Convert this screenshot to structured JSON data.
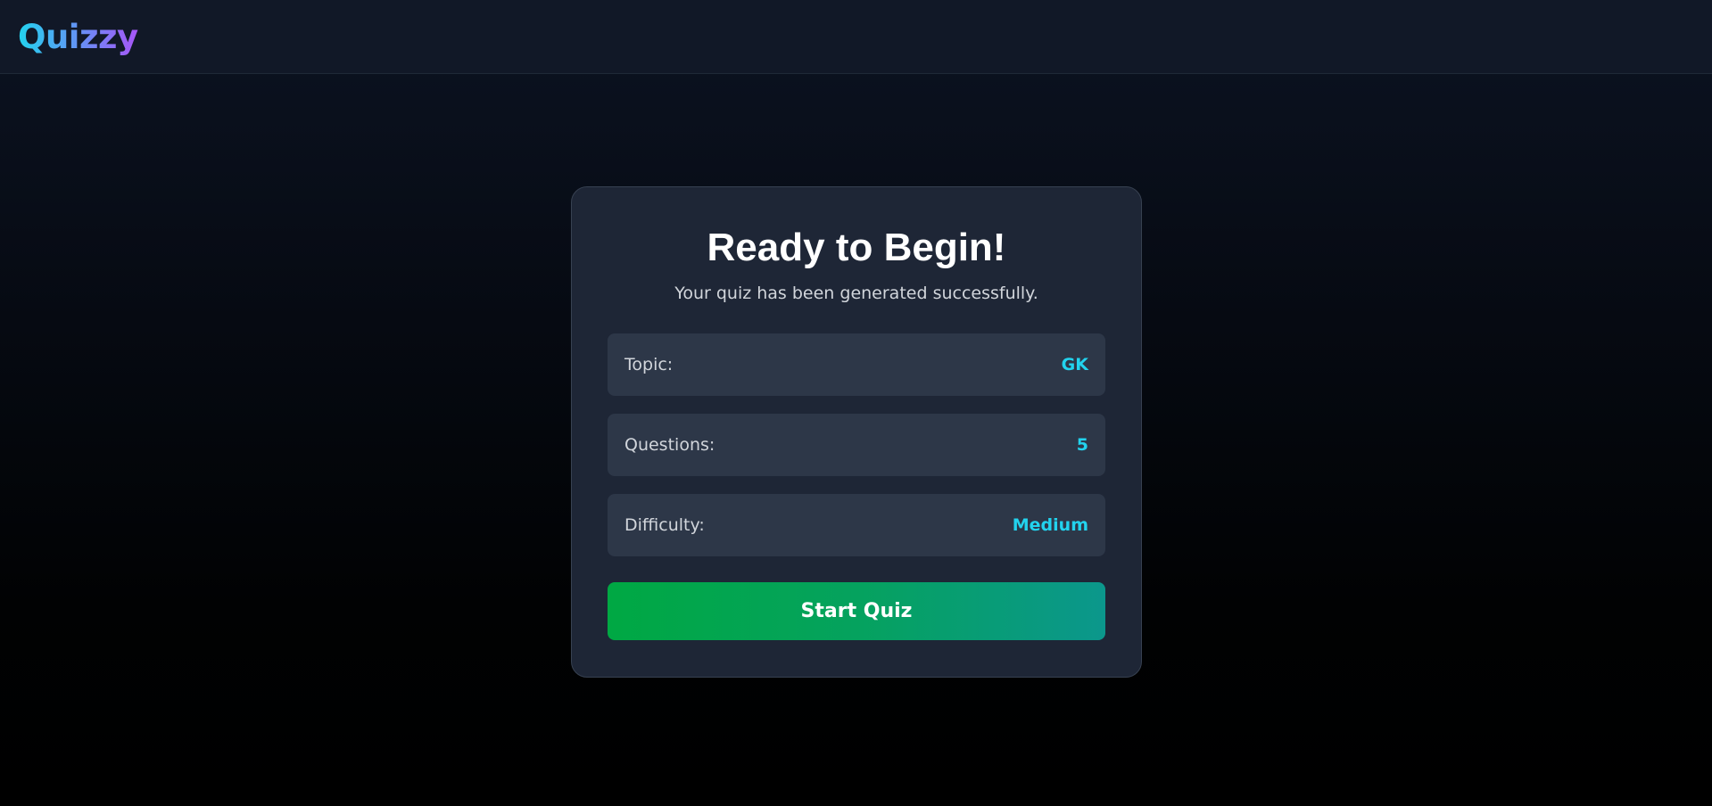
{
  "app": {
    "logo_text": "Quizzy"
  },
  "colors": {
    "accent": "#22d3ee",
    "logo_gradient_start": "#22d3ee",
    "logo_gradient_end": "#a855f7",
    "button_gradient_start": "#00a843",
    "button_gradient_end": "#0b978c",
    "card_background": "#1e2636",
    "row_background": "#2d3748"
  },
  "card": {
    "title": "Ready to Begin!",
    "subtitle": "Your quiz has been generated successfully.",
    "details": [
      {
        "label": "Topic:",
        "value": "GK"
      },
      {
        "label": "Questions:",
        "value": "5"
      },
      {
        "label": "Difficulty:",
        "value": "Medium"
      }
    ],
    "start_button_label": "Start Quiz"
  }
}
